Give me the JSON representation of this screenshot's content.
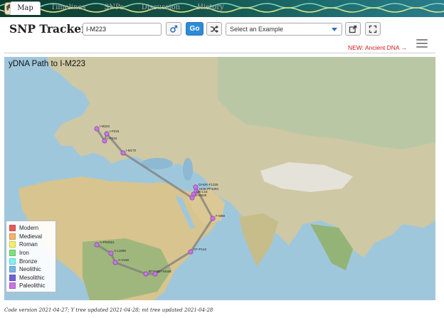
{
  "header": {
    "brand": "SNP Tracker",
    "snp_input_value": "I-M223",
    "go_label": "Go",
    "example_select_value": "Select an Example"
  },
  "tabs": [
    {
      "label": "Map",
      "active": true
    },
    {
      "label": "Timelines",
      "active": false
    },
    {
      "label": "SNPs",
      "active": false
    },
    {
      "label": "Discussion",
      "active": false
    },
    {
      "label": "History",
      "active": false
    }
  ],
  "ancient_link": "NEW: Ancient DNA →",
  "map": {
    "title": "yDNA Path to I-M223",
    "path_color": "#7d7d7d",
    "node_color": "#c873e6",
    "nodes": [
      {
        "label": "A-PR2921"
      },
      {
        "label": "A-L1090"
      },
      {
        "label": "A-V168"
      },
      {
        "label": "BT-M42"
      },
      {
        "label": "CT-M168"
      },
      {
        "label": "CF-P143"
      },
      {
        "label": "F-M89"
      },
      {
        "label": "GHIJK-F1329"
      },
      {
        "label": "HIJK-PF3494"
      },
      {
        "label": "IJK-L15"
      },
      {
        "label": "IJ-M429"
      },
      {
        "label": "I-M170"
      },
      {
        "label": "I-P215"
      },
      {
        "label": "I-P215"
      },
      {
        "label": "I-M223"
      }
    ]
  },
  "legend": [
    {
      "label": "Modern",
      "color": "#e85a5a"
    },
    {
      "label": "Medieval",
      "color": "#f3b36b"
    },
    {
      "label": "Roman",
      "color": "#f4f06a"
    },
    {
      "label": "Iron",
      "color": "#7de07d"
    },
    {
      "label": "Bronze",
      "color": "#7ef3f3"
    },
    {
      "label": "Neolithic",
      "color": "#78b4e6"
    },
    {
      "label": "Mesolithic",
      "color": "#6f62d9"
    },
    {
      "label": "Paleolithic",
      "color": "#c873e6"
    }
  ],
  "footer": "Code version 2021-04-27; Y tree updated 2021-04-28; mt tree updated 2021-04-28"
}
